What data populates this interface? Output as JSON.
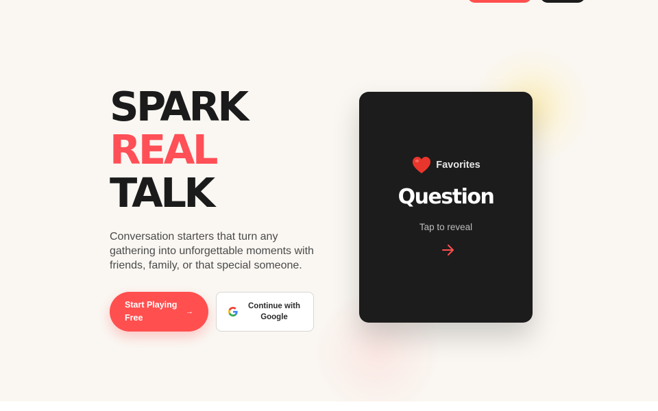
{
  "hero": {
    "headline": {
      "line1": "SPARK",
      "line2": "REAL",
      "line3": "TALK"
    },
    "subtext": "Conversation starters that turn any gathering into unforgettable moments with friends, family, or that special someone.",
    "primary_button": {
      "label": "Start Playing Free",
      "icon": "arrow-right-icon"
    },
    "google_button": {
      "label": "Continue with Google",
      "icon": "google-icon"
    }
  },
  "card": {
    "category_icon": "heart-icon",
    "category": "Favorites",
    "title": "Question",
    "hint": "Tap to reveal",
    "action_icon": "arrow-right-icon"
  },
  "colors": {
    "background": "#faf7f2",
    "accent": "#ff4f4f",
    "text_dark": "#1b1b1b",
    "card_background": "#1c1c1c"
  }
}
